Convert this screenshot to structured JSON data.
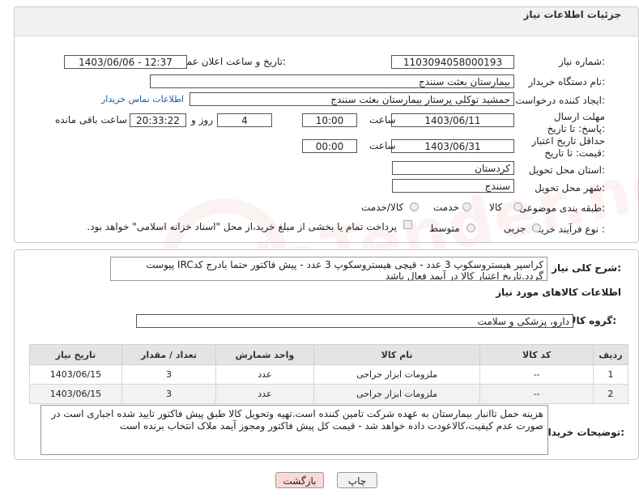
{
  "header": {
    "title": "جزئیات اطلاعات نیاز"
  },
  "fields": {
    "need_number_label": "شماره نیاز:",
    "need_number": "1103094058000193",
    "announce_label": "تاریخ و ساعت اعلان عمومی:",
    "announce_value": "1403/06/06 - 12:37",
    "buyer_org_label": "نام دستگاه خریدار:",
    "buyer_org": "بیمارستان بعثت سنندج",
    "requester_label": "ایجاد کننده درخواست:",
    "requester": "جمشید  توکلی پرستار بیمارستان بعثت سنندج",
    "buyer_contact_link": "اطلاعات تماس خریدار",
    "deadline_label": "مهلت ارسال پاسخ: تا تاریخ:",
    "deadline_date": "1403/06/11",
    "time_label": "ساعت",
    "deadline_time": "10:00",
    "days_value": "4",
    "days_label": "روز و",
    "remaining_time": "20:33:22",
    "remaining_label": "ساعت باقی مانده",
    "price_validity_label": "حداقل تاریخ اعتبار قیمت: تا تاریخ:",
    "price_validity_date": "1403/06/31",
    "price_validity_time": "00:00",
    "province_label": "استان محل تحویل:",
    "province": "کردستان",
    "city_label": "شهر محل تحویل:",
    "city": "سنندج",
    "category_label": "طبقه بندی موضوعی:",
    "category_options": [
      "کالا",
      "خدمت",
      "کالا/خدمت"
    ],
    "purchase_type_label": "نوع فرآیند خرید :",
    "purchase_options": [
      "جزیی",
      "متوسط"
    ],
    "payment_note": "پرداخت تمام یا بخشی از مبلغ خرید،از محل \"اسناد خزانه اسلامی\" خواهد بود."
  },
  "description": {
    "label": "شرح کلی نیاز:",
    "text": "کراسپر هیستروسکوپ 3 عدد - قیچی هیستروسکوپ 3 عدد - پیش فاکتور حتما بادرج کدIRC پیوست گردد.تاریخ اعتبار کالا در آیمد فعال باشد"
  },
  "goods": {
    "section_title": "اطلاعات کالاهای مورد نیاز",
    "group_label": "گروه کالا:",
    "group_value": "دارو، پزشکی و سلامت",
    "columns": [
      "ردیف",
      "کد کالا",
      "نام کالا",
      "واحد شمارش",
      "تعداد / مقدار",
      "تاریخ نیاز"
    ],
    "rows": [
      [
        "1",
        "--",
        "ملزومات ابزار جراحی",
        "عدد",
        "3",
        "1403/06/15"
      ],
      [
        "2",
        "--",
        "ملزومات ابزار جراحی",
        "عدد",
        "3",
        "1403/06/15"
      ]
    ]
  },
  "buyer_notes": {
    "label": "توضیحات خریدار:",
    "text": "هزینه حمل تاانبار بیمارستان به عهده شرکت تامین کننده است.تهیه وتحویل کالا طبق پیش فاکتور تایید شده اجباری است در صورت عدم کیفیت،کالاعودت داده خواهد شد - قیمت کل پیش فاکتور ومجوز آیمد ملاک انتخاب برنده است"
  },
  "buttons": {
    "print": "چاپ",
    "back": "بازگشت"
  },
  "watermark": "AriaTender.net",
  "colors": {
    "link": "#1a5aa8",
    "back_button_bg": "#f9d9d9",
    "header_bg": "#f1f1f1"
  }
}
